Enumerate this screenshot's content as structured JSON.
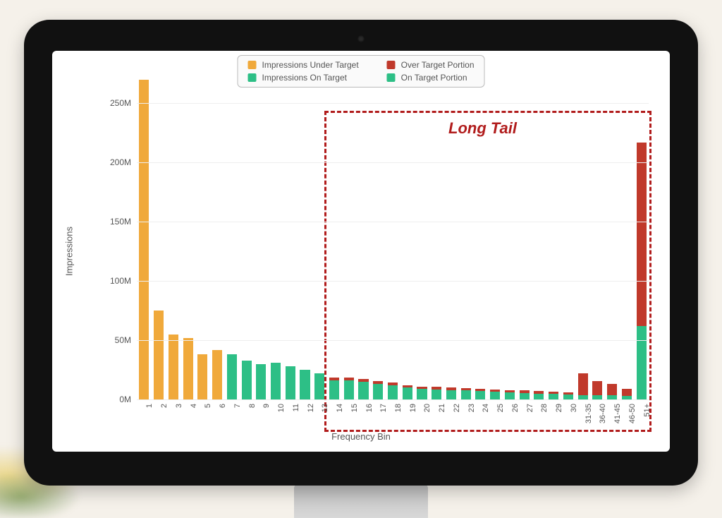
{
  "colors": {
    "under": "#f0a93b",
    "on": "#2dbf86",
    "over_portion": "#c0392b",
    "on_portion": "#2dbf86",
    "annotation": "#b11c1c"
  },
  "legend": {
    "under": "Impressions Under Target",
    "on": "Impressions On Target",
    "over_portion": "Over Target Portion",
    "on_portion": "On Target Portion"
  },
  "axes": {
    "ylabel": "Impressions",
    "xlabel": "Frequency Bin"
  },
  "annotation": {
    "long_tail": "Long Tail"
  },
  "chart_data": {
    "type": "bar",
    "ylabel": "Impressions",
    "xlabel": "Frequency Bin",
    "y_ticks": [
      "0M",
      "50M",
      "100M",
      "150M",
      "200M",
      "250M"
    ],
    "ylim": [
      0,
      280000000
    ],
    "long_tail_start_index": 13,
    "categories": [
      "1",
      "2",
      "3",
      "4",
      "5",
      "6",
      "7",
      "8",
      "9",
      "10",
      "11",
      "12",
      "13",
      "14",
      "15",
      "16",
      "17",
      "18",
      "19",
      "20",
      "21",
      "22",
      "23",
      "24",
      "25",
      "26",
      "27",
      "28",
      "29",
      "30",
      "31-35",
      "36-40",
      "41-45",
      "46-50",
      "51+"
    ],
    "series": [
      {
        "name": "Impressions Under Target",
        "color_key": "under",
        "values": [
          270000000,
          75000000,
          55000000,
          52000000,
          38000000,
          42000000,
          0,
          0,
          0,
          0,
          0,
          0,
          0,
          0,
          0,
          0,
          0,
          0,
          0,
          0,
          0,
          0,
          0,
          0,
          0,
          0,
          0,
          0,
          0,
          0,
          0,
          0,
          0,
          0,
          0
        ]
      },
      {
        "name": "Impressions On Target",
        "color_key": "on",
        "values": [
          0,
          0,
          0,
          0,
          0,
          0,
          38000000,
          33000000,
          30000000,
          31000000,
          28000000,
          25000000,
          22000000,
          0,
          0,
          0,
          0,
          0,
          0,
          0,
          0,
          0,
          0,
          0,
          0,
          0,
          0,
          0,
          0,
          0,
          0,
          0,
          0,
          0,
          0
        ]
      },
      {
        "name": "On Target Portion",
        "color_key": "on_portion",
        "values": [
          0,
          0,
          0,
          0,
          0,
          0,
          0,
          0,
          0,
          0,
          0,
          0,
          0,
          16000000,
          16000000,
          15000000,
          13000000,
          12000000,
          10000000,
          9000000,
          8500000,
          8000000,
          7500000,
          7000000,
          6500000,
          6000000,
          5500000,
          5000000,
          4500000,
          4000000,
          3800000,
          3600000,
          3400000,
          3200000,
          62000000
        ]
      },
      {
        "name": "Over Target Portion",
        "color_key": "over_portion",
        "values": [
          0,
          0,
          0,
          0,
          0,
          0,
          0,
          0,
          0,
          0,
          0,
          0,
          0,
          2500000,
          2500000,
          2500000,
          2500000,
          2500000,
          2200000,
          2000000,
          2000000,
          2000000,
          2000000,
          2000000,
          2000000,
          2000000,
          2000000,
          2000000,
          2000000,
          2000000,
          18000000,
          12000000,
          10000000,
          6000000,
          155000000
        ]
      }
    ]
  }
}
